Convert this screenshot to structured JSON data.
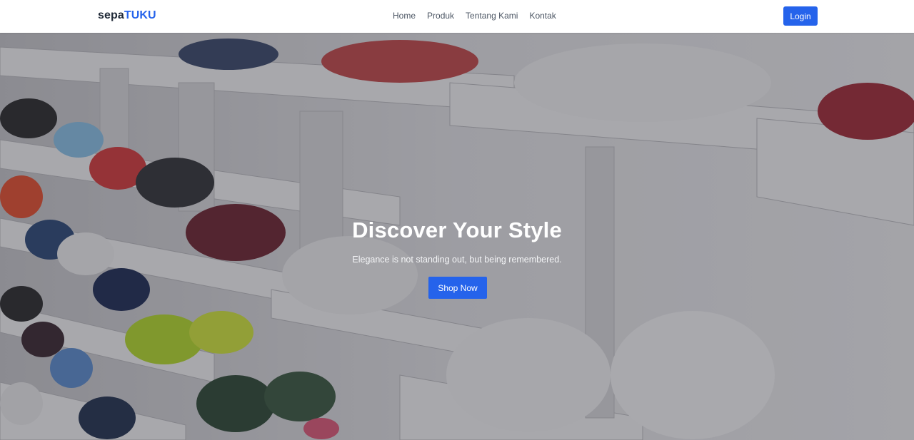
{
  "brand": {
    "prefix": "sepa",
    "accent": "TUKU",
    "accent_color": "#2563eb"
  },
  "nav": {
    "links": [
      {
        "label": "Home"
      },
      {
        "label": "Produk"
      },
      {
        "label": "Tentang Kami"
      },
      {
        "label": "Kontak"
      }
    ],
    "login_label": "Login"
  },
  "hero": {
    "title": "Discover Your Style",
    "subtitle": "Elegance is not standing out, but being remembered.",
    "cta_label": "Shop Now",
    "background": "shoe-store-shelves-photo"
  },
  "colors": {
    "primary": "#2563eb",
    "navbar_bg": "#ffffff",
    "text_dark": "#1f2937"
  }
}
